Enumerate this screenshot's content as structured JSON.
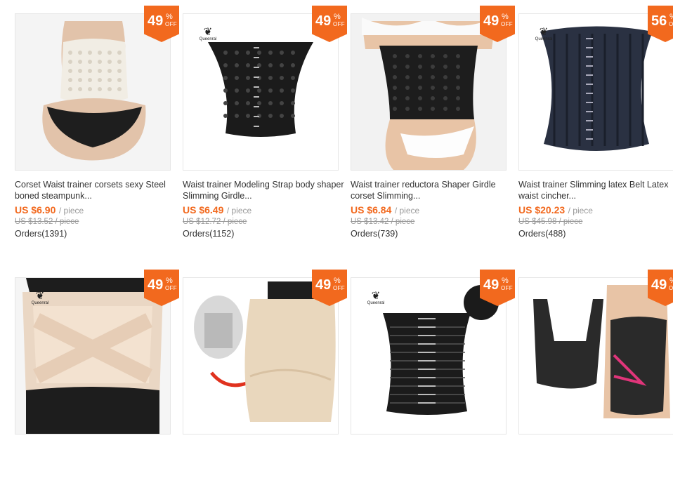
{
  "products": [
    {
      "discount": "49",
      "brand": "",
      "title": "Corset Waist trainer corsets sexy Steel boned steampunk...",
      "price": "US $6.90",
      "unit": "/ piece",
      "original": "US $13.52 / piece",
      "orders": "Orders(1391)",
      "image": "beige-mesh-corset-back-view"
    },
    {
      "discount": "49",
      "brand": "Queenral",
      "title": "Waist trainer Modeling Strap body shaper Slimming Girdle...",
      "price": "US $6.49",
      "unit": "/ piece",
      "original": "US $12.72 / piece",
      "orders": "Orders(1152)",
      "image": "black-mesh-waist-trainer"
    },
    {
      "discount": "49",
      "brand": "",
      "title": "Waist trainer reductora Shaper Girdle corset Slimming...",
      "price": "US $6.84",
      "unit": "/ piece",
      "original": "US $13.42 / piece",
      "orders": "Orders(739)",
      "image": "black-waist-trainer-worn"
    },
    {
      "discount": "56",
      "brand": "Queenral",
      "title": "Waist trainer Slimming latex Belt Latex waist cincher...",
      "price": "US $20.23",
      "unit": "/ piece",
      "original": "US $45.98 / piece",
      "orders": "Orders(488)",
      "image": "steel-boned-latex-cincher"
    },
    {
      "discount": "49",
      "brand": "Queenral",
      "title": "",
      "price": "",
      "unit": "",
      "original": "",
      "orders": "",
      "image": "nude-cross-waist-shaper"
    },
    {
      "discount": "49",
      "brand": "",
      "title": "",
      "price": "",
      "unit": "",
      "original": "",
      "orders": "",
      "image": "beige-high-waist-shaper-brief"
    },
    {
      "discount": "49",
      "brand": "Queenral",
      "title": "",
      "price": "",
      "unit": "",
      "original": "",
      "orders": "",
      "image": "black-hook-waist-cincher"
    },
    {
      "discount": "49",
      "brand": "",
      "title": "",
      "price": "",
      "unit": "",
      "original": "",
      "orders": "",
      "image": "black-mesh-bodysuit-shaper"
    }
  ],
  "badge_pct": "%",
  "badge_off": "OFF",
  "colors": {
    "accent": "#f2691e",
    "text": "#333333",
    "muted": "#999999",
    "border": "#e6e6e6"
  }
}
